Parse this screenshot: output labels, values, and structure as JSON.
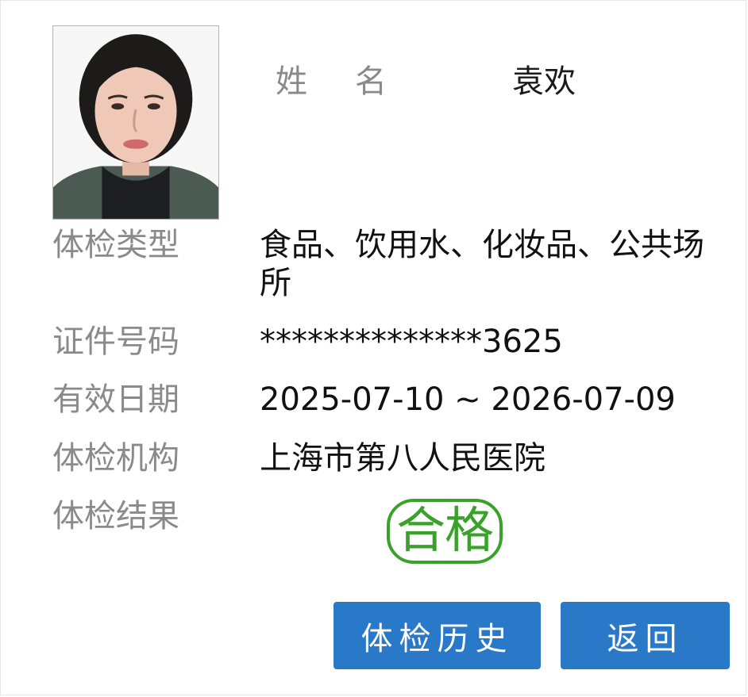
{
  "profile": {
    "photo_alt": "",
    "name_label_chars": [
      "姓",
      "名"
    ],
    "name_value": "袁欢"
  },
  "details": {
    "exam_type_label": "体检类型",
    "exam_type_value": "食品、饮用水、化妆品、公共场所",
    "id_number_label": "证件号码",
    "id_number_value": "**************3625",
    "validity_label": "有效日期",
    "validity_value": "2025-07-10 ~ 2026-07-09",
    "institution_label": "体检机构",
    "institution_value": "上海市第八人民医院",
    "result_label": "体检结果",
    "result_value": "合格"
  },
  "actions": {
    "history_label": "体检历史",
    "back_label": "返回"
  },
  "colors": {
    "button_bg": "#2a78c8",
    "result_stamp": "#3aa12a",
    "label_text": "#8a8a8a"
  }
}
